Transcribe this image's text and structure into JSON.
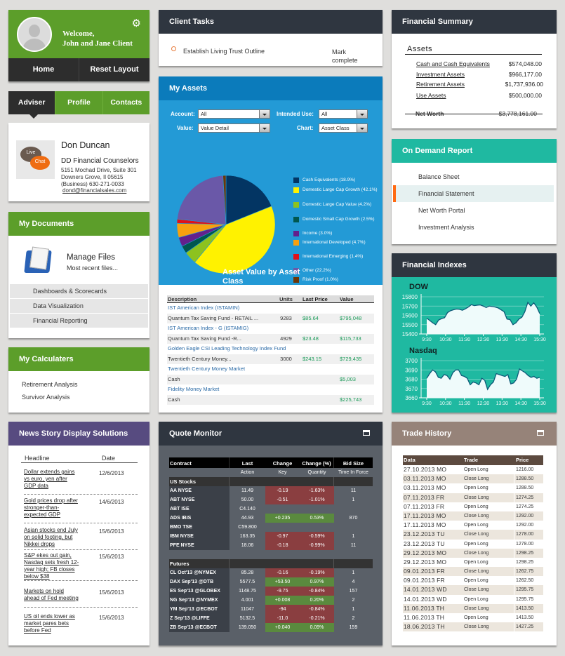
{
  "welcome": {
    "greeting": "Welcome,",
    "client_name": "John and Jane Client",
    "nav": [
      "Home",
      "Reset  Layout"
    ]
  },
  "adviser_tabs": [
    "Adviser",
    "Profile",
    "Contacts"
  ],
  "adviser": {
    "live_label": "Live",
    "chat_label": "Chat",
    "name": "Don Duncan",
    "firm": "DD Financial Counselors",
    "address1": "5151 Mochad Drive, Suite 301",
    "address2": "Downers Grove, Il 05615",
    "phone": "(Business) 630-271-0033",
    "email": "dond@financialsales.com"
  },
  "documents": {
    "title": "My Documents",
    "manage_title": "Manage Files",
    "manage_sub": "Most recent files...",
    "items": [
      "Dashboards & Scorecards",
      "Data Visualization",
      "Financial Reporting"
    ]
  },
  "calculators": {
    "title": "My Calculaters",
    "items": [
      "Retirement Analysis",
      "Survivor Analysis"
    ]
  },
  "news": {
    "title": "News  Story Display Solutions",
    "col_headline": "Headline",
    "col_date": "Date",
    "items": [
      {
        "headline": "Dollar extends gains vs euro, yen after GDP data",
        "date": "12/6/2013"
      },
      {
        "headline": "Gold prices drop after stronger-than-expected GDP",
        "date": "14/6/2013"
      },
      {
        "headline": "Asian stocks end July on solid footing, but Nikkei drops",
        "date": "15/6/2013"
      },
      {
        "headline": "S&P ekes out gain, Nasdaq sets fresh 12-year high; FB closes below $38",
        "date": "15/6/2013"
      },
      {
        "headline": "Markets on hold ahead of Fed meeting",
        "date": "15/6/2013"
      },
      {
        "headline": "US oil ends lower as market pares bets before Fed",
        "date": "15/6/2013"
      }
    ]
  },
  "tasks": {
    "title": "Client Tasks",
    "items": [
      {
        "text": "Establish Living Trust Outline",
        "action": "Mark complete"
      }
    ]
  },
  "assets": {
    "title": "My Assets",
    "filters": {
      "account_label": "Account:",
      "account_value": "All",
      "intended_label": "Intended Use:",
      "intended_value": "All",
      "value_label": "Value:",
      "value_value": "Value Detail",
      "chart_label": "Chart:",
      "chart_value": "Asset Class"
    },
    "table_headers": [
      "Description",
      "Units",
      "Last Price",
      "Value"
    ],
    "rows": [
      {
        "desc": "IST American Index (ISTAMIN)",
        "units": "",
        "price": "",
        "value": "",
        "type": "link"
      },
      {
        "desc": "Quantum Tax Saving Fund - RETAIL ...",
        "units": "9283",
        "price": "$85.64",
        "value": "$795,048",
        "type": "alt"
      },
      {
        "desc": "IST American Index - G (ISTAMIG)",
        "units": "",
        "price": "",
        "value": "",
        "type": "link"
      },
      {
        "desc": "Quantum Tax Saving Fund -R...",
        "units": "4929",
        "price": "$23.48",
        "value": "$115,733",
        "type": "alt"
      },
      {
        "desc": "Golden Eagle CSI Leading Technology Index Fund",
        "units": "",
        "price": "",
        "value": "",
        "type": "link"
      },
      {
        "desc": "Twentieth Century Money...",
        "units": "3000",
        "price": "$243.15",
        "value": "$729,435",
        "type": "alt"
      },
      {
        "desc": "Twentieth Century Money Market",
        "units": "",
        "price": "",
        "value": "",
        "type": "link"
      },
      {
        "desc": "Cash",
        "units": "",
        "price": "",
        "value": "$5,003",
        "type": "alt"
      },
      {
        "desc": "Fidelity Money Market",
        "units": "",
        "price": "",
        "value": "",
        "type": "link"
      },
      {
        "desc": "Cash",
        "units": "",
        "price": "",
        "value": "$225,743",
        "type": "alt"
      }
    ]
  },
  "chart_data": [
    {
      "type": "pie",
      "title": "Asset Value by Asset Class",
      "legend_position": "right",
      "slices": [
        {
          "label": "Cash Equivalents (18.9%)",
          "value": 18.9,
          "color": "#033563"
        },
        {
          "label": "Domestic Large Cap Growth (42.1%)",
          "value": 42.1,
          "color": "#fff200"
        },
        {
          "label": "Domestic Large Cap Value (4.2%)",
          "value": 4.2,
          "color": "#8dc21f"
        },
        {
          "label": "Domestic Small Cap Growth (2.5%)",
          "value": 2.5,
          "color": "#00574f"
        },
        {
          "label": "Income (3.0%)",
          "value": 3.0,
          "color": "#63208c"
        },
        {
          "label": "International Developed (4.7%)",
          "value": 4.7,
          "color": "#f7a00f"
        },
        {
          "label": "International Emerging (1.4%)",
          "value": 1.4,
          "color": "#e0101a"
        },
        {
          "label": "Other (22.2%)",
          "value": 22.2,
          "color": "#6a58a8"
        },
        {
          "label": "Risk Proof (1.0%)",
          "value": 1.0,
          "color": "#6b3608"
        }
      ]
    },
    {
      "type": "area",
      "title": "DOW",
      "x_ticks": [
        "9:30",
        "10:30",
        "11:30",
        "12:30",
        "13:30",
        "14:30",
        "15:30"
      ],
      "y_ticks": [
        15400,
        15500,
        15600,
        15700,
        15800
      ],
      "ylim": [
        15400,
        15800
      ],
      "grid": true,
      "values": [
        15570,
        15545,
        15520,
        15500,
        15550,
        15565,
        15575,
        15630,
        15650,
        15660,
        15668,
        15665,
        15655,
        15670,
        15690,
        15715,
        15705,
        15710,
        15712,
        15700,
        15685,
        15700,
        15695,
        15690,
        15680,
        15660,
        15640,
        15560,
        15555,
        15500,
        15520,
        15560,
        15580,
        15640,
        15740,
        15700,
        15735,
        15690,
        15620
      ]
    },
    {
      "type": "area",
      "title": "Nasdaq",
      "x_ticks": [
        "9:30",
        "10:30",
        "11:30",
        "12:30",
        "13:30",
        "14:30",
        "15:30"
      ],
      "y_ticks": [
        3660,
        3670,
        3680,
        3690,
        3700
      ],
      "ylim": [
        3660,
        3700
      ],
      "grid": true,
      "values": [
        3681,
        3686,
        3690,
        3688,
        3682,
        3681,
        3685,
        3684,
        3680,
        3687,
        3690,
        3690,
        3684,
        3683,
        3681,
        3674,
        3677,
        3676,
        3674,
        3681,
        3679,
        3669,
        3674,
        3677,
        3686,
        3685,
        3684,
        3683,
        3685,
        3675,
        3676,
        3680,
        3691,
        3689,
        3687,
        3684,
        3682,
        3683,
        3681,
        3682
      ]
    }
  ],
  "quote": {
    "title": "Quote Monitor",
    "headers": [
      "Contract",
      "Last",
      "Change",
      "Change (%)",
      "Bid Size"
    ],
    "subheaders": [
      "",
      "Action",
      "Key",
      "Quantity",
      "Time In Force"
    ],
    "sections": [
      {
        "name": "US Stocks",
        "rows": [
          {
            "contract": "AA NYSE",
            "last": "11.49",
            "change": "-0.19",
            "pct": "-1.63%",
            "bid": "11",
            "dir": "neg"
          },
          {
            "contract": "ABT NYSE",
            "last": "50.00",
            "change": "-0.51",
            "pct": "-1.01%",
            "bid": "1",
            "dir": "neg"
          },
          {
            "contract": "ABT ISE",
            "last": "C4.140",
            "change": "",
            "pct": "",
            "bid": "",
            "dir": ""
          },
          {
            "contract": "ADS IBIS",
            "last": "44.93",
            "change": "+0.235",
            "pct": "0.53%",
            "bid": "870",
            "dir": "pos"
          },
          {
            "contract": "BMO TSE",
            "last": "C59.800",
            "change": "",
            "pct": "",
            "bid": "",
            "dir": ""
          },
          {
            "contract": "IBM NYSE",
            "last": "163.35",
            "change": "-0.97",
            "pct": "-0.59%",
            "bid": "1",
            "dir": "neg"
          },
          {
            "contract": "PFE NYSE",
            "last": "18.06",
            "change": "-0.18",
            "pct": "-0.99%",
            "bid": "11",
            "dir": "neg"
          }
        ]
      },
      {
        "name": "Futures",
        "rows": [
          {
            "contract": "CL Oct'13 @NYMEX",
            "last": "85.28",
            "change": "-0.16",
            "pct": "-0.19%",
            "bid": "1",
            "dir": "neg"
          },
          {
            "contract": "DAX Sep'13 @DTB",
            "last": "5577.5",
            "change": "+53.50",
            "pct": "0.97%",
            "bid": "4",
            "dir": "pos"
          },
          {
            "contract": "ES Sep'13 @GLOBEX",
            "last": "1148.75",
            "change": "-9.75",
            "pct": "-0.84%",
            "bid": "157",
            "dir": "neg"
          },
          {
            "contract": "NG Sep'13 @NYMEX",
            "last": "4.001",
            "change": "+0.008",
            "pct": "0.20%",
            "bid": "2",
            "dir": "pos"
          },
          {
            "contract": "YM Sep'13 @ECBOT",
            "last": "11047",
            "change": "-94",
            "pct": "-0.84%",
            "bid": "1",
            "dir": "neg"
          },
          {
            "contract": "Z Sep'13 @LIFFE",
            "last": "5132.5",
            "change": "-11.0",
            "pct": "-0.21%",
            "bid": "2",
            "dir": "neg"
          },
          {
            "contract": "ZB Sep'13 @ECBOT",
            "last": "139.050",
            "change": "+0.040",
            "pct": "0.09%",
            "bid": "159",
            "dir": "pos"
          }
        ]
      }
    ]
  },
  "fin_summary": {
    "title": "Financial Summary",
    "section": "Assets",
    "rows": [
      {
        "label": "Cash and Cash Equivalents",
        "value": "$574,048.00"
      },
      {
        "label": "Investment Assets",
        "value": "$966,177.00"
      },
      {
        "label": "Retirement Assets",
        "value": "$1,737,936.00"
      },
      {
        "label": "Use Assets",
        "value": "$500,000.00"
      }
    ],
    "net_worth_label": "Net Worth",
    "net_worth_value": "$3,778,161.00"
  },
  "demand": {
    "title": "On Demand Report",
    "items": [
      "Balance Sheet",
      "Financial Statement",
      "Net Worth Portal",
      "Investment Analysis"
    ],
    "active_index": 1,
    "accent": "#ff6a13"
  },
  "indexes": {
    "title": "Financial Indexes"
  },
  "trades": {
    "title": "Trade History",
    "headers": [
      "Data",
      "Trade",
      "Price"
    ],
    "rows": [
      [
        "27.10.2013 MO",
        "Open Long",
        "1216.00"
      ],
      [
        "03.11.2013 MO",
        "Close Long",
        "1288.50"
      ],
      [
        "03.11.2013 MO",
        "Open Long",
        "1288.50"
      ],
      [
        "07.11.2013 FR",
        "Close Long",
        "1274.25"
      ],
      [
        "07.11.2013 FR",
        "Open Long",
        "1274.25"
      ],
      [
        "17.11.2013 MO",
        "Close Long",
        "1292.00"
      ],
      [
        "17.11.2013 MO",
        "Open Long",
        "1292.00"
      ],
      [
        "23.12.2013 TU",
        "Close Long",
        "1278.00"
      ],
      [
        "23.12.2013 TU",
        "Open Long",
        "1278.00"
      ],
      [
        "29.12.2013 MO",
        "Close Long",
        "1298.25"
      ],
      [
        "29.12.2013 MO",
        "Open Long",
        "1298.25"
      ],
      [
        "09.01.2013 FR",
        "Close Long",
        "1262.75"
      ],
      [
        "09.01.2013 FR",
        "Open Long",
        "1262.50"
      ],
      [
        "14.01.2013 WD",
        "Close Long",
        "1295.75"
      ],
      [
        "14.01.2013 WD",
        "Open Long",
        "1295.75"
      ],
      [
        "11.06.2013 TH",
        "Close Long",
        "1413.50"
      ],
      [
        "11.06.2013 TH",
        "Open Long",
        "1413.50"
      ],
      [
        "18.06.2013 TH",
        "Close Long",
        "1427.25"
      ]
    ]
  }
}
